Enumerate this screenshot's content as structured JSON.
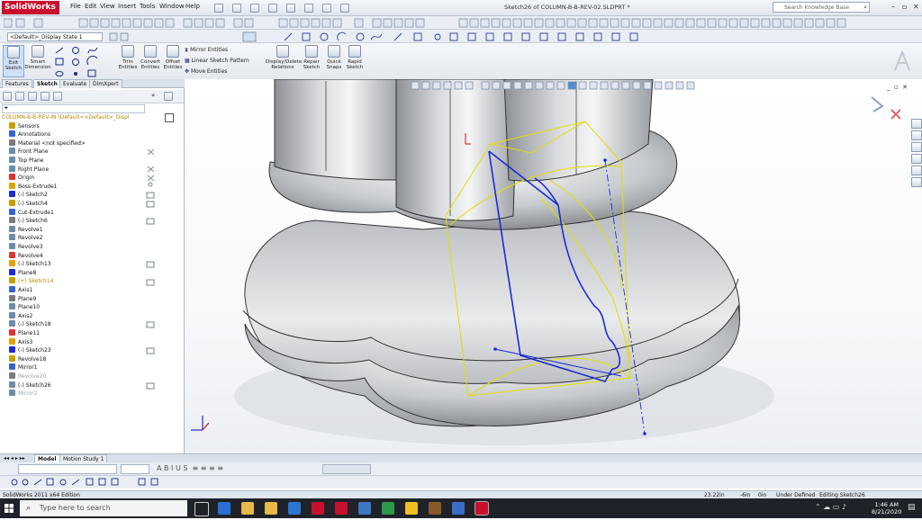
{
  "app": {
    "logo": "SolidWorks",
    "title": "Sketch26 of COLUMN-B-B-REV-02.SLDPRT *"
  },
  "menu": [
    "File",
    "Edit",
    "View",
    "Insert",
    "Tools",
    "Window",
    "Help"
  ],
  "search": {
    "placeholder": "Search Knowledge Base"
  },
  "config": {
    "value": "<Default>_Display State 1"
  },
  "commands": {
    "edit_sketch": [
      "Exit",
      "Sketch"
    ],
    "smart_dimension": [
      "Smart",
      "Dimension"
    ],
    "trim": [
      "Trim",
      "Entities"
    ],
    "convert": [
      "Convert",
      "Entities"
    ],
    "offset": [
      "Offset",
      "Entities"
    ],
    "mirror": "Mirror Entities",
    "linear_pattern": "Linear Sketch Pattern",
    "move": "Move Entities",
    "display_delete": [
      "Display/Delete",
      "Relations"
    ],
    "repair": [
      "Repair",
      "Sketch"
    ],
    "quick_snaps": [
      "Quick",
      "Snaps"
    ],
    "rapid_sketch": [
      "Rapid",
      "Sketch"
    ]
  },
  "tabs": [
    "Features",
    "Sketch",
    "Evaluate",
    "DimXpert"
  ],
  "tree": {
    "root": "COLUMN-B-B-REV-IN  (Default<<Default>_Displ",
    "items": [
      {
        "label": "Sensors",
        "style": ""
      },
      {
        "label": "Annotations",
        "style": ""
      },
      {
        "label": "Material <not specified>",
        "style": ""
      },
      {
        "label": "Front Plane",
        "style": ""
      },
      {
        "label": "Top Plane",
        "style": ""
      },
      {
        "label": "Right Plane",
        "style": ""
      },
      {
        "label": "Origin",
        "style": ""
      },
      {
        "label": "Boss-Extrude1",
        "style": ""
      },
      {
        "label": "(-) Sketch2",
        "style": ""
      },
      {
        "label": "(-) Sketch4",
        "style": ""
      },
      {
        "label": "Cut-Extrude1",
        "style": ""
      },
      {
        "label": "(-) Sketch6",
        "style": ""
      },
      {
        "label": "Revolve1",
        "style": ""
      },
      {
        "label": "Revolve2",
        "style": ""
      },
      {
        "label": "Revolve3",
        "style": ""
      },
      {
        "label": "Revolve4",
        "style": ""
      },
      {
        "label": "(-) Sketch13",
        "style": ""
      },
      {
        "label": "Plane8",
        "style": ""
      },
      {
        "label": "(+) Sketch14",
        "style": "warn"
      },
      {
        "label": "Axis1",
        "style": ""
      },
      {
        "label": "Plane9",
        "style": ""
      },
      {
        "label": "Plane10",
        "style": ""
      },
      {
        "label": "Axis2",
        "style": ""
      },
      {
        "label": "(-) Sketch18",
        "style": ""
      },
      {
        "label": "Plane11",
        "style": ""
      },
      {
        "label": "Axis3",
        "style": ""
      },
      {
        "label": "(-) Sketch23",
        "style": ""
      },
      {
        "label": "Revolve18",
        "style": ""
      },
      {
        "label": "Mirror1",
        "style": ""
      },
      {
        "label": "Revolve20",
        "style": "faded"
      },
      {
        "label": "(-) Sketch26",
        "style": ""
      },
      {
        "label": "Mirror2",
        "style": "faded"
      }
    ]
  },
  "bottom_tabs": [
    "Model",
    "Motion Study 1"
  ],
  "status": {
    "edition": "SolidWorks 2011 x64 Edition",
    "x": "23.22in",
    "y": "-6in",
    "z": "0in",
    "state": "Under Defined",
    "editing": "Editing Sketch26"
  },
  "taskbar": {
    "search_placeholder": "Type here to search",
    "time": "1:46 AM",
    "date": "8/21/2020"
  },
  "colors": {
    "accent": "#c8102e",
    "sketch_blue": "#1a2bd6",
    "preview_yellow": "#e6e600"
  }
}
